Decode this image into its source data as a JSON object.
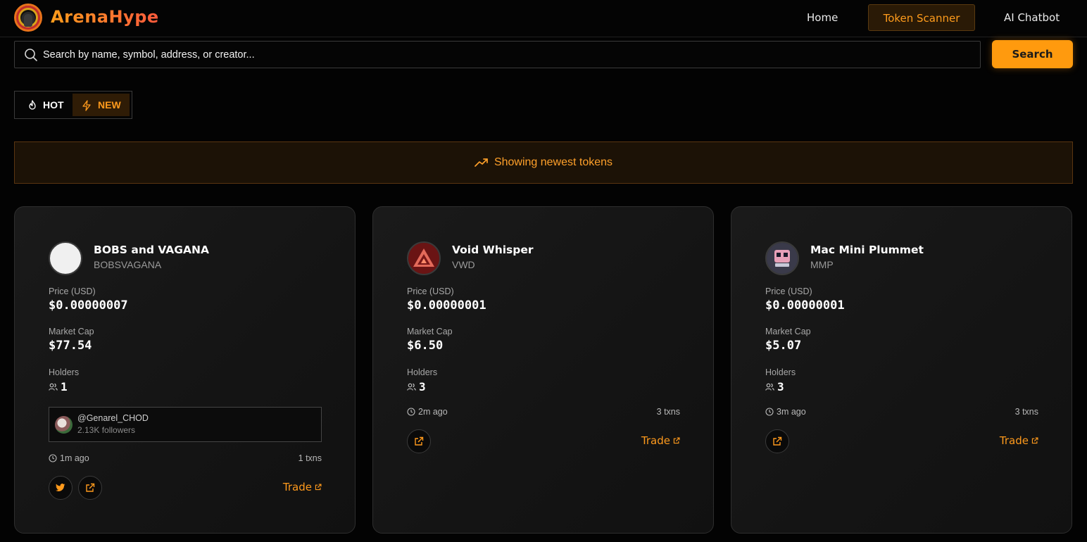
{
  "header": {
    "brand": "ArenaHype",
    "nav": [
      {
        "label": "Home"
      },
      {
        "label": "Token Scanner",
        "active": true
      },
      {
        "label": "AI Chatbot"
      }
    ]
  },
  "search": {
    "placeholder": "Search by name, symbol, address, or creator...",
    "value": "",
    "button_label": "Search"
  },
  "tabs": [
    {
      "label": "HOT",
      "icon": "flame-icon",
      "active": false
    },
    {
      "label": "NEW",
      "icon": "lightning-icon",
      "active": true
    }
  ],
  "banner": {
    "text": "Showing newest tokens",
    "icon": "trending-up-icon"
  },
  "labels": {
    "price": "Price (USD)",
    "market_cap": "Market Cap",
    "holders": "Holders",
    "trade": "Trade"
  },
  "tokens": [
    {
      "name": "BOBS and VAGANA",
      "symbol": "BOBSVAGANA",
      "price": "$0.00000007",
      "market_cap": "$77.54",
      "holders": "1",
      "creator": {
        "handle": "@Genarel_CHOD",
        "followers": "2.13K followers"
      },
      "time": "1m ago",
      "txns": "1 txns"
    },
    {
      "name": "Void Whisper",
      "symbol": "VWD",
      "price": "$0.00000001",
      "market_cap": "$6.50",
      "holders": "3",
      "time": "2m ago",
      "txns": "3 txns"
    },
    {
      "name": "Mac Mini Plummet",
      "symbol": "MMP",
      "price": "$0.00000001",
      "market_cap": "$5.07",
      "holders": "3",
      "time": "3m ago",
      "txns": "3 txns"
    }
  ],
  "colors": {
    "accent": "#ff9a0e",
    "background": "#030303",
    "card": "#171717"
  }
}
